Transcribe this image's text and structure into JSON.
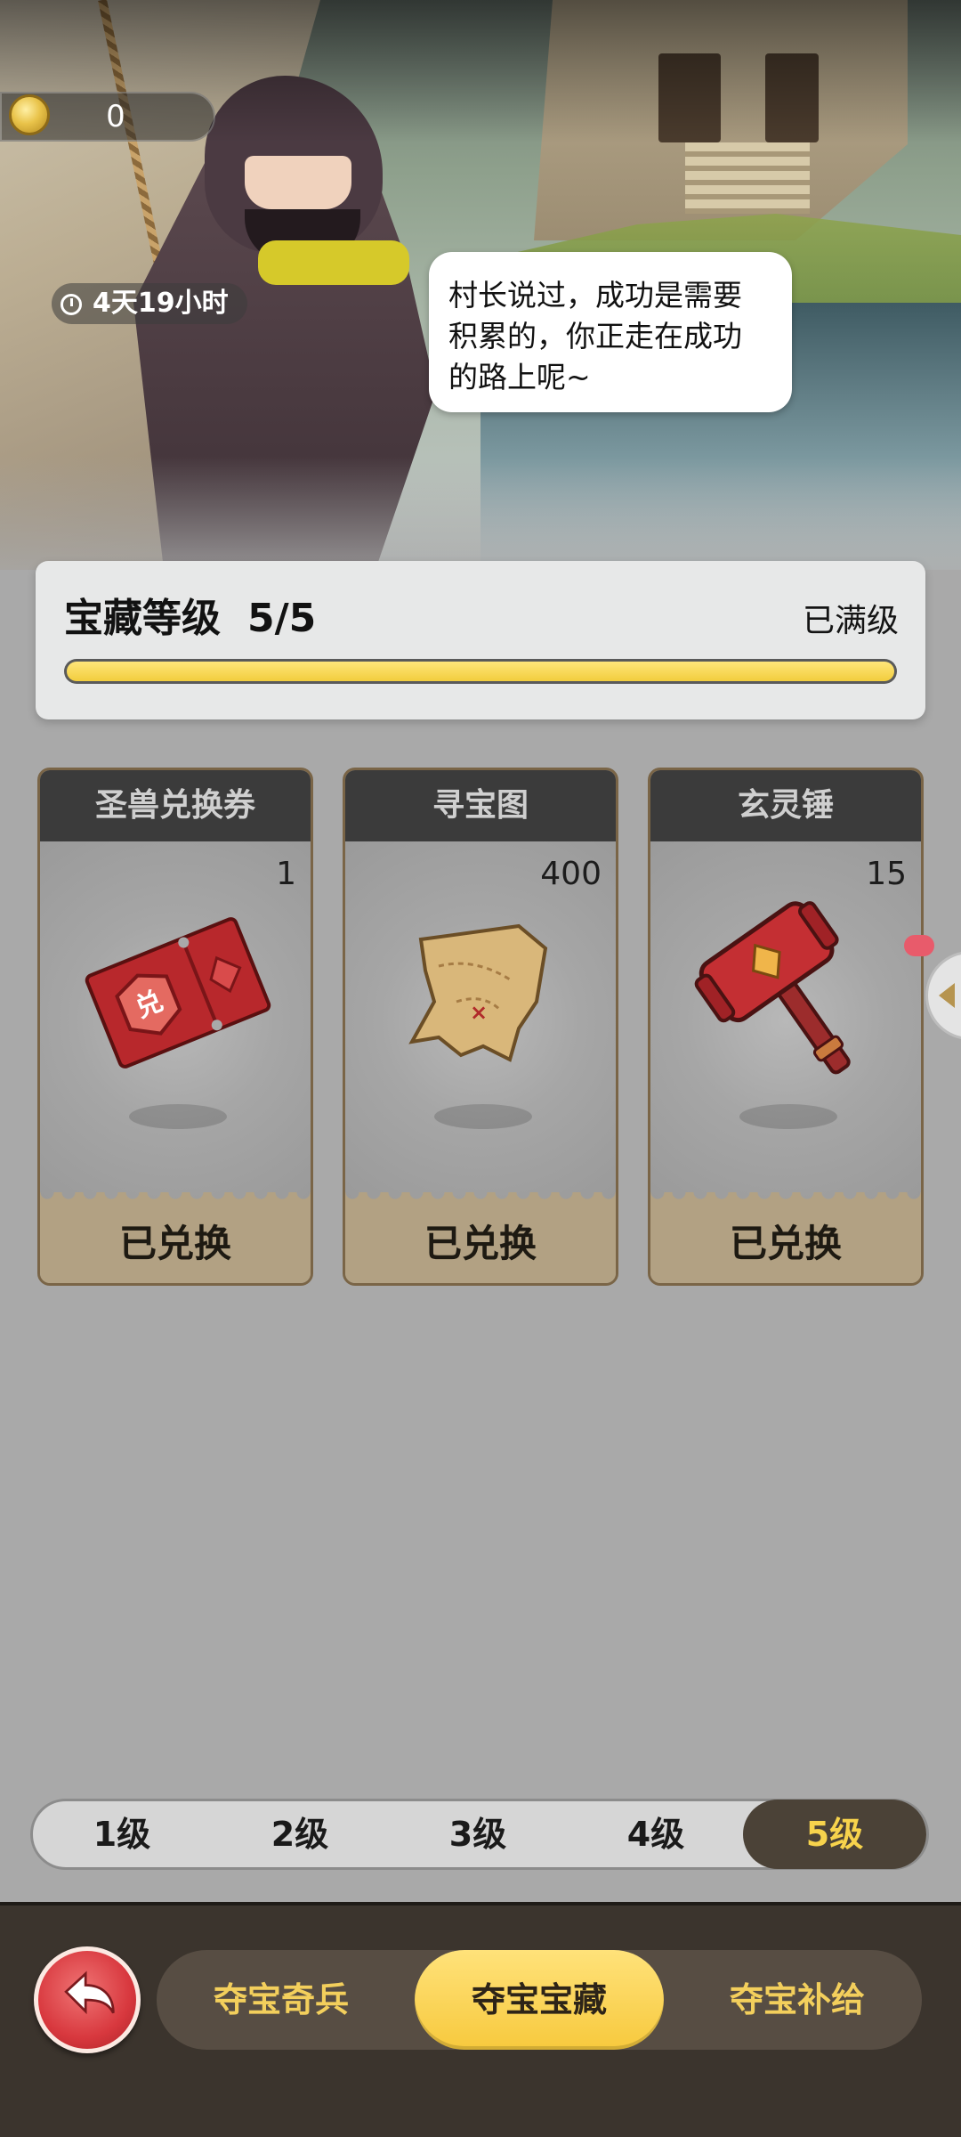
{
  "header": {
    "coin_value": "0",
    "timer": "4天19小时",
    "speech": "村长说过，成功是需要积累的，你正走在成功的路上呢~"
  },
  "treasure": {
    "title": "宝藏等级",
    "level": "5/5",
    "status": "已满级",
    "progress": 1.0
  },
  "rewards": [
    {
      "name": "圣兽兑换券",
      "count": "1",
      "button": "已兑换",
      "icon": "ticket-icon"
    },
    {
      "name": "寻宝图",
      "count": "400",
      "button": "已兑换",
      "icon": "treasure-map-icon"
    },
    {
      "name": "玄灵锤",
      "count": "15",
      "button": "已兑换",
      "icon": "hammer-icon"
    }
  ],
  "level_tabs": [
    "1级",
    "2级",
    "3级",
    "4级",
    "5级"
  ],
  "active_level": "5级",
  "bottom_nav": {
    "tabs": [
      "夺宝奇兵",
      "夺宝宝藏",
      "夺宝补给"
    ],
    "active": "夺宝宝藏"
  },
  "colors": {
    "accent_yellow": "#f7c93d",
    "back_red": "#d8383e",
    "nav_bg": "#3b342d"
  }
}
